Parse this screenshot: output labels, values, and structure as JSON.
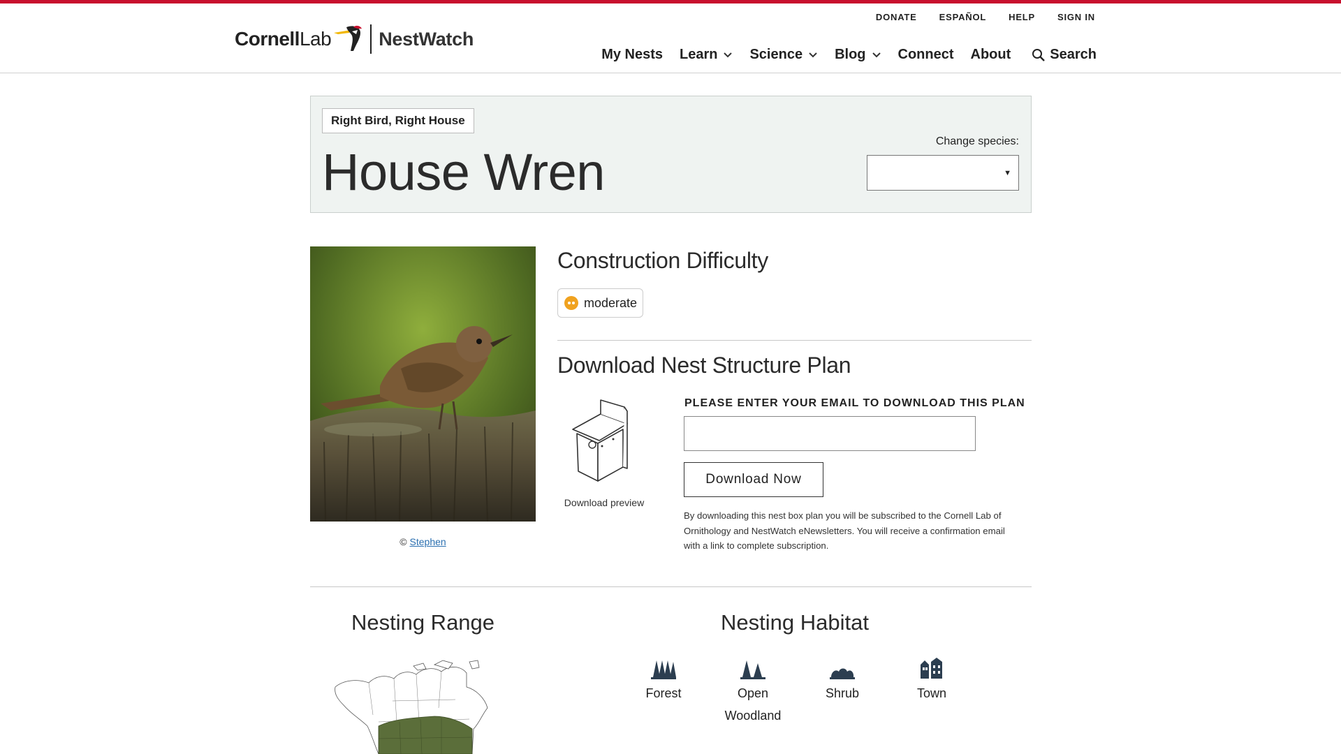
{
  "brand": {
    "org_bold": "Cornell",
    "org_light": "Lab",
    "product": "NestWatch"
  },
  "utility_nav": [
    "DONATE",
    "ESPAÑOL",
    "HELP",
    "SIGN IN"
  ],
  "main_nav": {
    "my_nests": "My Nests",
    "learn": "Learn",
    "science": "Science",
    "blog": "Blog",
    "connect": "Connect",
    "about": "About",
    "search": "Search"
  },
  "species_panel": {
    "tag": "Right Bird, Right House",
    "title": "House Wren",
    "change_label": "Change species:",
    "selected_value": ""
  },
  "photo": {
    "credit_prefix": "©",
    "credit_name": "Stephen"
  },
  "difficulty": {
    "heading": "Construction Difficulty",
    "level": "moderate"
  },
  "download": {
    "heading": "Download Nest Structure Plan",
    "preview_label": "Download preview",
    "email_label": "PLEASE ENTER YOUR EMAIL TO DOWNLOAD THIS PLAN",
    "email_value": "",
    "button": "Download Now",
    "disclaimer": "By downloading this nest box plan you will be subscribed to the Cornell Lab of Ornithology and NestWatch eNewsletters. You will receive a confirmation email with a link to complete subscription."
  },
  "range": {
    "heading": "Nesting Range"
  },
  "habitat": {
    "heading": "Nesting Habitat",
    "items": [
      "Forest",
      "Open Woodland",
      "Shrub",
      "Town"
    ]
  },
  "colors": {
    "accent_red": "#c8102e",
    "panel_bg": "#eff3f1",
    "difficulty_orange": "#f0a21f",
    "range_green": "#5b6e3a",
    "link_blue": "#2a6fb0"
  }
}
